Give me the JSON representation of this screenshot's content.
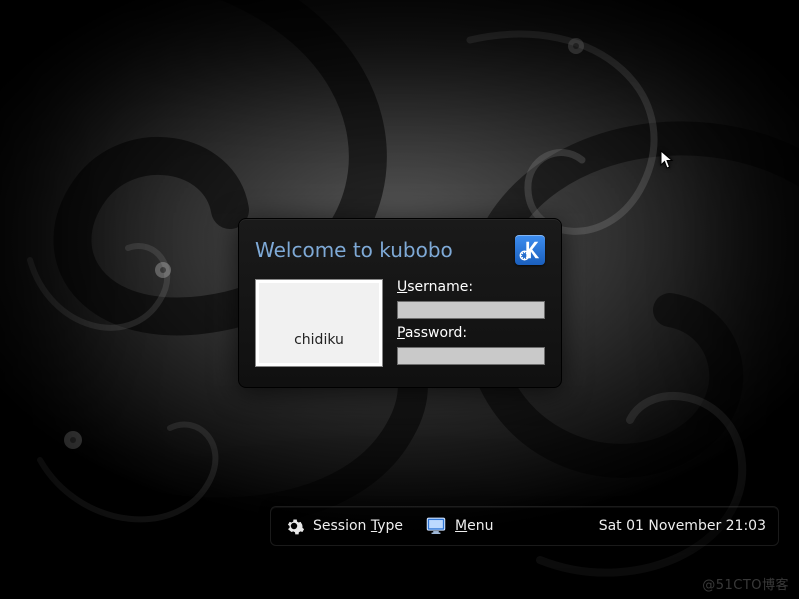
{
  "login": {
    "title": "Welcome to kubobo",
    "selected_user": "chidiku",
    "username_label_prefix": "U",
    "username_label_rest": "sername:",
    "password_label_prefix": "P",
    "password_label_rest": "assword:",
    "username_value": "",
    "password_value": ""
  },
  "bottombar": {
    "session_type_label": "Session ",
    "session_type_underline": "T",
    "session_type_rest": "ype",
    "menu_underline": "M",
    "menu_rest": "enu",
    "datetime": "Sat 01 November 21:03"
  },
  "watermark": "@51CTO博客"
}
